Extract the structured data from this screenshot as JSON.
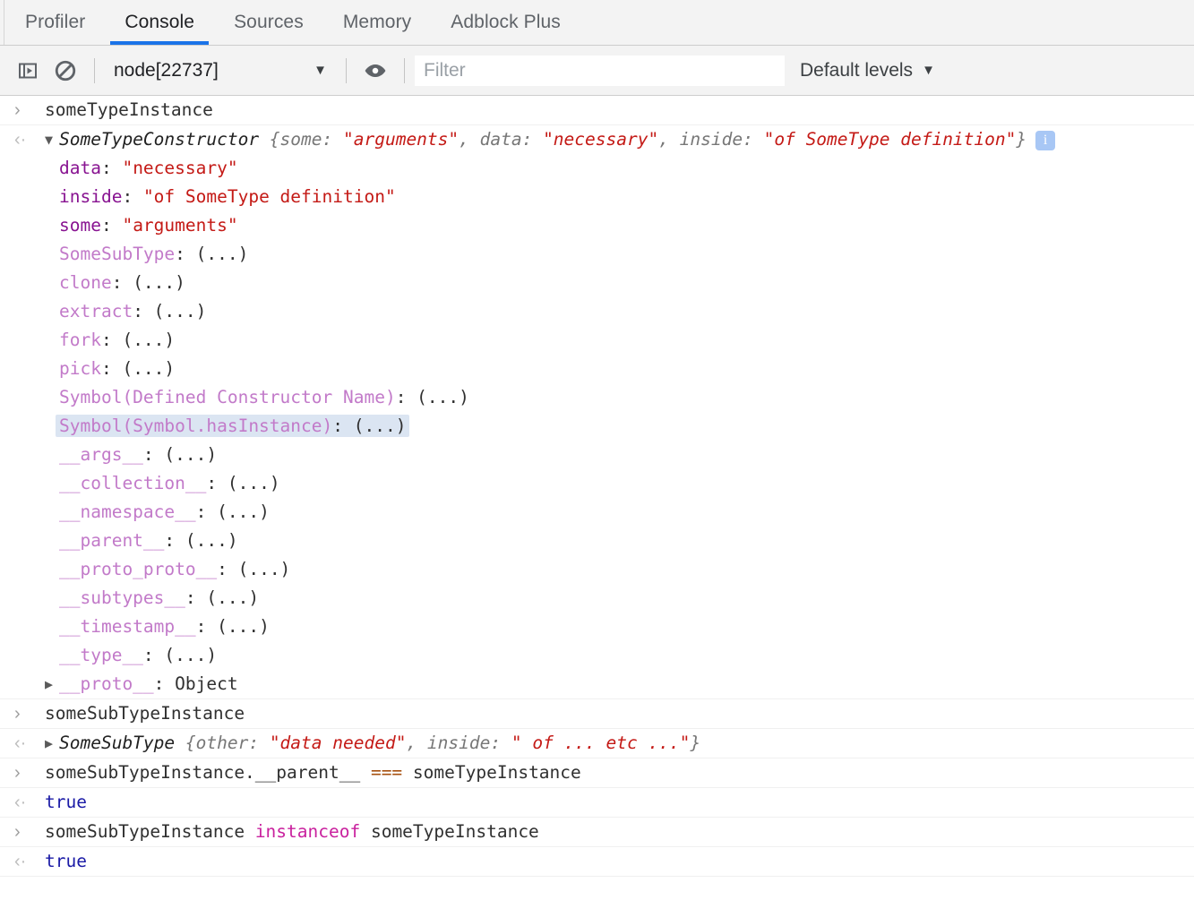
{
  "colors": {
    "accent": "#1a73e8",
    "string": "#c41a16",
    "key_own": "#881391",
    "key_dim": "#c27ac9",
    "boolean": "#1a1aa6",
    "keyword": "#c9219e",
    "operator": "#a6500f",
    "selection": "#dbe5f2",
    "toolbar_bg": "#f3f3f3"
  },
  "tabs": [
    {
      "label": "Profiler",
      "active": false
    },
    {
      "label": "Console",
      "active": true
    },
    {
      "label": "Sources",
      "active": false
    },
    {
      "label": "Memory",
      "active": false
    },
    {
      "label": "Adblock Plus",
      "active": false
    }
  ],
  "toolbar": {
    "sidebar_icon": "console-sidebar-icon",
    "clear_icon": "clear-console-icon",
    "context_value": "node[22737]",
    "context_caret": "▼",
    "eye_icon": "eye-icon",
    "filter_placeholder": "Filter",
    "filter_value": "",
    "levels_label": "Default levels",
    "levels_caret": "▼"
  },
  "console": {
    "messages": [
      {
        "kind": "input",
        "gutter": "❯",
        "text": "someTypeInstance"
      },
      {
        "kind": "output-object",
        "gutter": "❮",
        "triangle": "▼",
        "constructor": "SomeTypeConstructor",
        "preview_open": " {",
        "preview_parts": [
          {
            "t": "key",
            "v": "some: "
          },
          {
            "t": "str",
            "v": "\"arguments\""
          },
          {
            "t": "key",
            "v": ", data: "
          },
          {
            "t": "str",
            "v": "\"necessary\""
          },
          {
            "t": "key",
            "v": ", inside: "
          },
          {
            "t": "str",
            "v": "\"of SomeType definition\""
          }
        ],
        "preview_close": "}",
        "badge": "i",
        "properties": [
          {
            "name": "data",
            "dim": false,
            "sep": ": ",
            "value": "\"necessary\"",
            "value_type": "str",
            "selected": false
          },
          {
            "name": "inside",
            "dim": false,
            "sep": ": ",
            "value": "\"of SomeType definition\"",
            "value_type": "str",
            "selected": false
          },
          {
            "name": "some",
            "dim": false,
            "sep": ": ",
            "value": "\"arguments\"",
            "value_type": "str",
            "selected": false
          },
          {
            "name": "SomeSubType",
            "dim": true,
            "sep": ": ",
            "value": "(...)",
            "value_type": "dots",
            "selected": false
          },
          {
            "name": "clone",
            "dim": true,
            "sep": ": ",
            "value": "(...)",
            "value_type": "dots",
            "selected": false
          },
          {
            "name": "extract",
            "dim": true,
            "sep": ": ",
            "value": "(...)",
            "value_type": "dots",
            "selected": false
          },
          {
            "name": "fork",
            "dim": true,
            "sep": ": ",
            "value": "(...)",
            "value_type": "dots",
            "selected": false
          },
          {
            "name": "pick",
            "dim": true,
            "sep": ": ",
            "value": "(...)",
            "value_type": "dots",
            "selected": false
          },
          {
            "name": "Symbol(Defined Constructor Name)",
            "dim": true,
            "sep": ": ",
            "value": "(...)",
            "value_type": "dots",
            "selected": false
          },
          {
            "name": "Symbol(Symbol.hasInstance)",
            "dim": true,
            "sep": ": ",
            "value": "(...)",
            "value_type": "dots",
            "selected": true
          },
          {
            "name": "__args__",
            "dim": true,
            "sep": ": ",
            "value": "(...)",
            "value_type": "dots",
            "selected": false
          },
          {
            "name": "__collection__",
            "dim": true,
            "sep": ": ",
            "value": "(...)",
            "value_type": "dots",
            "selected": false
          },
          {
            "name": "__namespace__",
            "dim": true,
            "sep": ": ",
            "value": "(...)",
            "value_type": "dots",
            "selected": false
          },
          {
            "name": "__parent__",
            "dim": true,
            "sep": ": ",
            "value": "(...)",
            "value_type": "dots",
            "selected": false
          },
          {
            "name": "__proto_proto__",
            "dim": true,
            "sep": ": ",
            "value": "(...)",
            "value_type": "dots",
            "selected": false
          },
          {
            "name": "__subtypes__",
            "dim": true,
            "sep": ": ",
            "value": "(...)",
            "value_type": "dots",
            "selected": false
          },
          {
            "name": "__timestamp__",
            "dim": true,
            "sep": ": ",
            "value": "(...)",
            "value_type": "dots",
            "selected": false
          },
          {
            "name": "__type__",
            "dim": true,
            "sep": ": ",
            "value": "(...)",
            "value_type": "dots",
            "selected": false
          }
        ],
        "proto": {
          "triangle": "▶",
          "name": "__proto__",
          "sep": ": ",
          "value": "Object"
        }
      },
      {
        "kind": "input",
        "gutter": "❯",
        "text": "someSubTypeInstance"
      },
      {
        "kind": "output-object-collapsed",
        "gutter": "❮",
        "triangle": "▶",
        "constructor": "SomeSubType",
        "preview_open": " {",
        "preview_parts": [
          {
            "t": "key",
            "v": "other: "
          },
          {
            "t": "str",
            "v": "\"data needed\""
          },
          {
            "t": "key",
            "v": ", inside: "
          },
          {
            "t": "str",
            "v": "\" of ... etc ...\""
          }
        ],
        "preview_close": "}"
      },
      {
        "kind": "input-tokens",
        "gutter": "❯",
        "tokens": [
          {
            "t": "plain",
            "v": "someSubTypeInstance.__parent__ "
          },
          {
            "t": "op",
            "v": "==="
          },
          {
            "t": "plain",
            "v": " someTypeInstance"
          }
        ]
      },
      {
        "kind": "output-value",
        "gutter": "❮",
        "value": "true",
        "value_type": "bool"
      },
      {
        "kind": "input-tokens",
        "gutter": "❯",
        "tokens": [
          {
            "t": "plain",
            "v": "someSubTypeInstance "
          },
          {
            "t": "kw",
            "v": "instanceof"
          },
          {
            "t": "plain",
            "v": " someTypeInstance"
          }
        ]
      },
      {
        "kind": "output-value",
        "gutter": "❮",
        "value": "true",
        "value_type": "bool"
      }
    ]
  }
}
